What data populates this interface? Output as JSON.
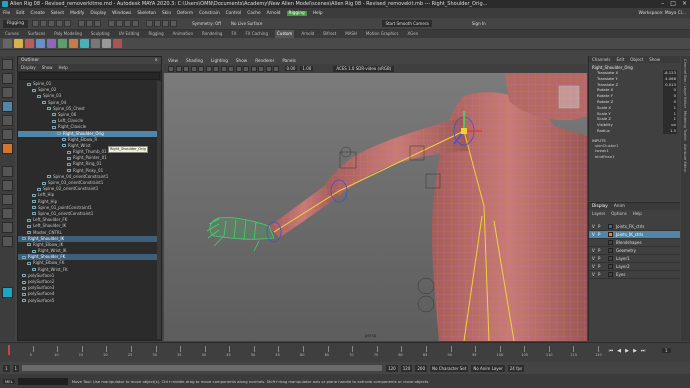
{
  "window": {
    "title": "Alien Rig 08 - Revised_removerkitme.md - Autodesk MAYA 2020.3: C:\\Users\\OMN\\Documents\\Academy\\New Alien Model\\scenes\\Alien Rig 08 - Revised_removekit.mb --- Right_Shoulder_Orig...",
    "controls": [
      "–",
      "□",
      "×"
    ]
  },
  "menubar": {
    "items": [
      "File",
      "Edit",
      "Create",
      "Select",
      "Modify",
      "Display",
      "Windows",
      "Skeleton",
      "Skin",
      "Deform",
      "Constrain",
      "Control",
      "Cache",
      "Arnold",
      "Rigging",
      "Help"
    ],
    "workspace_label": "Workspace: Maya Cl..."
  },
  "statusline": {
    "mode": "Rigging",
    "symmetry": "Symmetry: Off",
    "live_surface": "No Live Surface",
    "sign_in": "Sign In",
    "smooth_camera": "Start Smooth Camera"
  },
  "shelf_tabs": [
    "Curves",
    "Surfaces",
    "Poly Modeling",
    "Sculpting",
    "UV Editing",
    "Rigging",
    "Animation",
    "Rendering",
    "FX",
    "FX Caching",
    "Custom",
    "Arnold",
    "Bifrost",
    "MASH",
    "Motion Graphics",
    "XGen"
  ],
  "shelf_active_tab": "Custom",
  "outliner": {
    "title": "Outliner",
    "menu": [
      "Display",
      "Show",
      "Help"
    ],
    "nodes": [
      {
        "label": "Spine_01",
        "indent": 1,
        "sel": ""
      },
      {
        "label": "Spine_02",
        "indent": 2,
        "sel": ""
      },
      {
        "label": "Spine_03",
        "indent": 3,
        "sel": ""
      },
      {
        "label": "Spine_04",
        "indent": 4,
        "sel": ""
      },
      {
        "label": "Spine_05_Chest",
        "indent": 5,
        "sel": ""
      },
      {
        "label": "Spine_06",
        "indent": 6,
        "sel": ""
      },
      {
        "label": "Left_Clavicle",
        "indent": 6,
        "sel": ""
      },
      {
        "label": "Right_Clavicle",
        "indent": 6,
        "sel": ""
      },
      {
        "label": "Right_Shoulder_Orig",
        "indent": 7,
        "sel": "sel"
      },
      {
        "label": "Right_Elbow_R",
        "indent": 8,
        "sel": ""
      },
      {
        "label": "Right_Wrist",
        "indent": 8,
        "sel": ""
      },
      {
        "label": "Right_Thumb_01",
        "indent": 9,
        "sel": ""
      },
      {
        "label": "Right_Pointer_01",
        "indent": 9,
        "sel": ""
      },
      {
        "label": "Right_Ring_01",
        "indent": 9,
        "sel": ""
      },
      {
        "label": "Right_Pinky_01",
        "indent": 9,
        "sel": ""
      },
      {
        "label": "Spine_04_orientConstraint1",
        "indent": 5,
        "sel": ""
      },
      {
        "label": "Spine_03_orientConstraint1",
        "indent": 4,
        "sel": ""
      },
      {
        "label": "Spine_02_orientConstraint1",
        "indent": 3,
        "sel": ""
      },
      {
        "label": "Left_Hip",
        "indent": 2,
        "sel": ""
      },
      {
        "label": "Right_Hip",
        "indent": 2,
        "sel": ""
      },
      {
        "label": "Spine_01_pointConstraint1",
        "indent": 2,
        "sel": ""
      },
      {
        "label": "Spine_01_orientConstraint1",
        "indent": 2,
        "sel": ""
      },
      {
        "label": "Left_Shoulder_FK",
        "indent": 1,
        "sel": ""
      },
      {
        "label": "Left_Shoulder_IK",
        "indent": 1,
        "sel": ""
      },
      {
        "label": "Master_CNTRL",
        "indent": 1,
        "sel": ""
      },
      {
        "label": "Right_Shoulder_IK",
        "indent": 0,
        "sel": "sel2"
      },
      {
        "label": "Right_Elbow_IK",
        "indent": 1,
        "sel": ""
      },
      {
        "label": "Right_Wrist_IK",
        "indent": 2,
        "sel": ""
      },
      {
        "label": "Right_Shoulder_FK",
        "indent": 0,
        "sel": "sel2"
      },
      {
        "label": "Right_Elbow_FK",
        "indent": 1,
        "sel": ""
      },
      {
        "label": "Right_Wrist_FK",
        "indent": 2,
        "sel": ""
      },
      {
        "label": "polySurface1",
        "indent": 0,
        "sel": ""
      },
      {
        "label": "polySurface2",
        "indent": 0,
        "sel": ""
      },
      {
        "label": "polySurface3",
        "indent": 0,
        "sel": ""
      },
      {
        "label": "polySurface4",
        "indent": 0,
        "sel": ""
      },
      {
        "label": "polySurface5",
        "indent": 0,
        "sel": ""
      }
    ],
    "tooltip": "Right_Shoulder_Orig"
  },
  "viewport": {
    "menu": [
      "View",
      "Shading",
      "Lighting",
      "Show",
      "Renderer",
      "Panels"
    ],
    "color_space": "ACES 1.0 SDR-video (sRGB)",
    "exposure": "0.00",
    "gamma": "1.00",
    "camera_label": "persp"
  },
  "channelbox": {
    "menu": [
      "Channels",
      "Edit",
      "Object",
      "Show"
    ],
    "object": "Right_Shoulder_Orig",
    "attrs": [
      {
        "name": "Translate X",
        "value": "-8.123"
      },
      {
        "name": "Translate Y",
        "value": "4.066"
      },
      {
        "name": "Translate Z",
        "value": "0.013"
      },
      {
        "name": "Rotate X",
        "value": "0"
      },
      {
        "name": "Rotate Y",
        "value": "0"
      },
      {
        "name": "Rotate Z",
        "value": "0"
      },
      {
        "name": "Scale X",
        "value": "1"
      },
      {
        "name": "Scale Y",
        "value": "1"
      },
      {
        "name": "Scale Z",
        "value": "1"
      },
      {
        "name": "Visibility",
        "value": "on"
      },
      {
        "name": "Radius",
        "value": "1.5"
      }
    ],
    "inputs_label": "INPUTS",
    "inputs": [
      "skinCluster1",
      "tweak1",
      "bindPose1"
    ]
  },
  "side_tabs": [
    "Channel Box / Layer Editor",
    "Modeling Toolkit",
    "Attribute Editor"
  ],
  "layers": {
    "tabs": [
      "Display",
      "Anim"
    ],
    "menu": [
      "Layers",
      "Options",
      "Help"
    ],
    "items": [
      {
        "v": "V",
        "p": "P",
        "color": "#2a6acd",
        "name": "Joints_FK_ctrls",
        "sel": ""
      },
      {
        "v": "V",
        "p": "P",
        "color": "#ff8800",
        "name": "Joints_IK_ctrls",
        "sel": "sel"
      },
      {
        "v": "",
        "p": "",
        "color": "#444444",
        "name": "Blendshapes",
        "sel": ""
      },
      {
        "v": "V",
        "p": "P",
        "color": "#444444",
        "name": "Geometry",
        "sel": ""
      },
      {
        "v": "V",
        "p": "P",
        "color": "#444444",
        "name": "Layer1",
        "sel": ""
      },
      {
        "v": "V",
        "p": "P",
        "color": "#444444",
        "name": "Layer2",
        "sel": ""
      },
      {
        "v": "V",
        "p": "P",
        "color": "#444444",
        "name": "Eyes",
        "sel": ""
      }
    ]
  },
  "timeline": {
    "ticks": [
      "5",
      "10",
      "15",
      "20",
      "25",
      "30",
      "35",
      "40",
      "45",
      "50",
      "55",
      "60",
      "65",
      "70",
      "75",
      "80",
      "85",
      "90",
      "95",
      "100",
      "105",
      "110",
      "115",
      "120"
    ],
    "current_frame": "1"
  },
  "range": {
    "start": "1",
    "range_start": "1",
    "range_end": "120",
    "end": "120",
    "end2": "200",
    "character_set": "No Character Set",
    "anim_layer": "No Anim Layer",
    "fps": "24 fps"
  },
  "helpline": {
    "text": "Move Tool: Use manipulator to move object(s). Ctrl+middle-drag to move components along normals. Shift+drag manipulator axis or plane handle to extrude components or clone objects.",
    "mel_label": "MEL"
  },
  "colors": {
    "selection": "#5285a6",
    "skin": "#c77b73",
    "wire_pink": "#e06fd7",
    "wire_green": "#3fe06a",
    "joint_yellow": "#f0d23a"
  }
}
